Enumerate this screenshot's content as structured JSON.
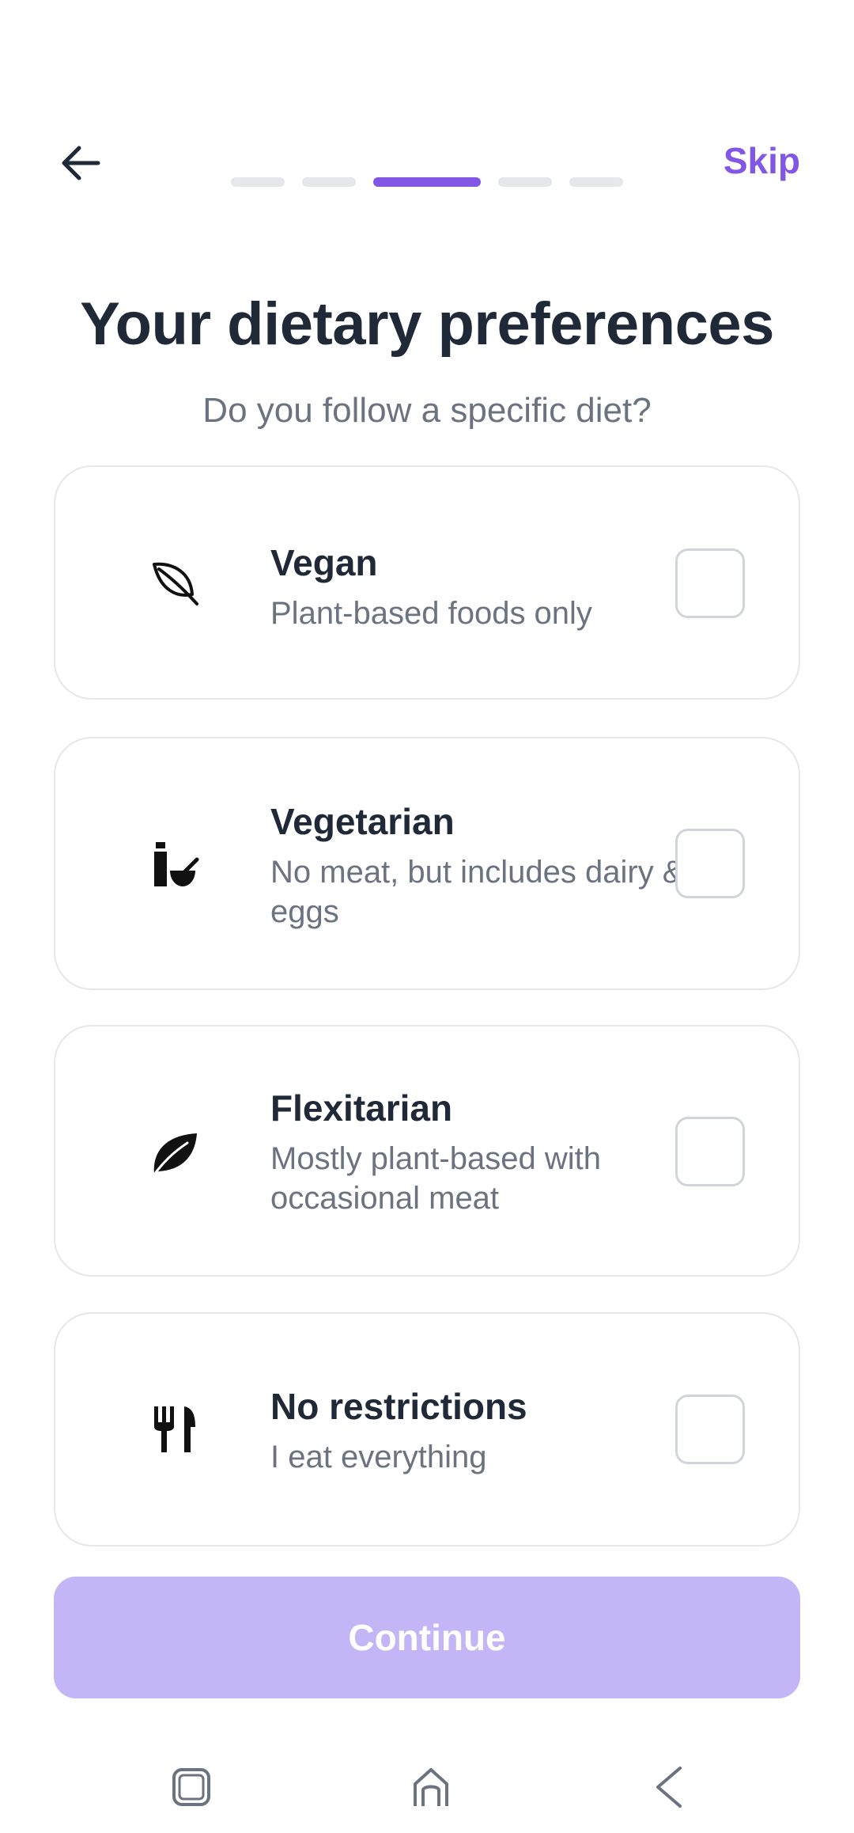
{
  "header": {
    "back_icon": "arrow-left-icon",
    "skip_label": "Skip",
    "progress_steps": 5,
    "progress_current_step": 3,
    "accent_color": "#8257e6"
  },
  "title": "Your dietary preferences",
  "subtitle": "Do you follow a specific diet?",
  "options": [
    {
      "icon": "leaf-outline-icon",
      "label": "Vegan",
      "description": "Plant-based foods only",
      "checked": false
    },
    {
      "icon": "milk-bottle-bowl-icon",
      "label": "Vegetarian",
      "description": "No meat, but includes dairy & eggs",
      "checked": false
    },
    {
      "icon": "leaf-filled-icon",
      "label": "Flexitarian",
      "description": "Mostly plant-based with occasional meat",
      "checked": false
    },
    {
      "icon": "fork-knife-icon",
      "label": "No restrictions",
      "description": "I eat everything",
      "checked": false
    }
  ],
  "continue_label": "Continue",
  "continue_color": "#c4b5f7",
  "system_nav": {
    "recents_icon": "recents-square-icon",
    "home_icon": "home-icon",
    "back_icon": "back-chevron-icon"
  }
}
